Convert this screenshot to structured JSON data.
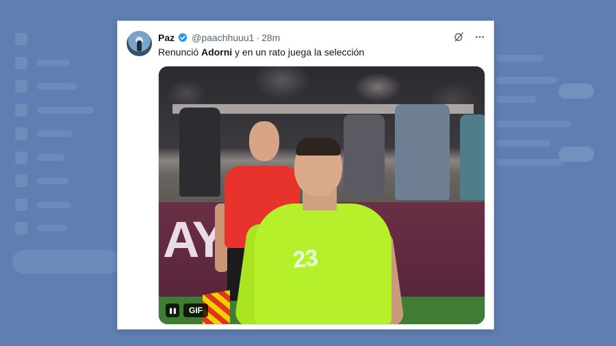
{
  "tweet": {
    "author_name": "Paz",
    "handle": "@paachhuuu1",
    "separator": "·",
    "time": "28m",
    "text_before": "Renunció ",
    "text_bold": "Adorni",
    "text_after": " y en un rato juega la selección"
  },
  "media": {
    "board_text": "AYS",
    "jersey_number": "23",
    "gif_badge": "GIF",
    "pause_glyph": "❚❚"
  },
  "icons": {
    "verified": "verified-badge-icon",
    "grok": "grok-icon",
    "more": "more-icon",
    "pause": "pause-icon"
  },
  "colors": {
    "background": "#5f7fb2",
    "verified_blue": "#1d9bf0",
    "keeper_jersey": "#b5f02a",
    "referee_shirt": "#e8322c"
  }
}
